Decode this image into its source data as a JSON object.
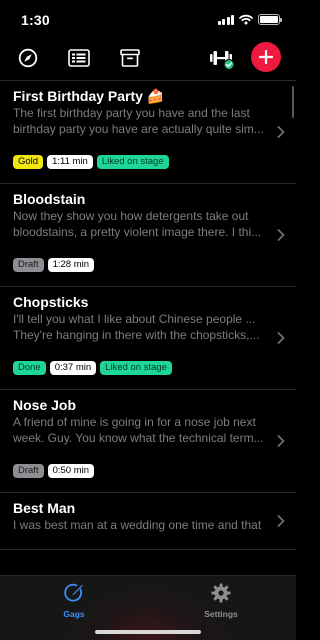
{
  "status_bar": {
    "time": "1:30"
  },
  "toolbar": {
    "icons": [
      "compass-icon",
      "list-icon",
      "archive-icon",
      "dumbbell-icon",
      "plus-icon"
    ]
  },
  "gags": [
    {
      "title": "First Birthday Party 🍰",
      "body_line1": "The first birthday party you have and the last",
      "body_line2": "birthday party you have are actually quite sim...",
      "tags": [
        {
          "text": "Gold",
          "style": "gold"
        },
        {
          "text": "1:11 min",
          "style": "time"
        },
        {
          "text": "Liked on stage",
          "style": "liked"
        }
      ]
    },
    {
      "title": "Bloodstain",
      "body_line1": "Now they show you how detergents take out",
      "body_line2": "bloodstains, a pretty violent image there. I thi...",
      "tags": [
        {
          "text": "Draft",
          "style": "draft"
        },
        {
          "text": "1:28 min",
          "style": "time"
        }
      ]
    },
    {
      "title": "Chopsticks",
      "body_line1": "I'll tell you what I like about Chinese people ...",
      "body_line2": "They're hanging in there with the chopsticks,...",
      "tags": [
        {
          "text": "Done",
          "style": "done"
        },
        {
          "text": "0:37 min",
          "style": "time"
        },
        {
          "text": "Liked on stage",
          "style": "liked"
        }
      ]
    },
    {
      "title": "Nose Job",
      "body_line1": "A friend of mine is going in for a nose job next",
      "body_line2": "week. Guy. You know what the technical term...",
      "tags": [
        {
          "text": "Draft",
          "style": "draft"
        },
        {
          "text": "0:50 min",
          "style": "time"
        }
      ]
    },
    {
      "title": "Best Man",
      "body_line1": "I was best man at a wedding one time and that",
      "body_line2": "",
      "tags": []
    }
  ],
  "tag_styles": {
    "gold": {
      "bg": "#f2e60e",
      "fg": "#000000",
      "border": "#f2e60e"
    },
    "time": {
      "bg": "#ffffff",
      "fg": "#000000",
      "border": "#ffffff"
    },
    "liked": {
      "bg": "#1fd69a",
      "fg": "#003a26",
      "border": "#1fd69a"
    },
    "draft": {
      "bg": "#8e8e93",
      "fg": "#1a1a1a",
      "border": "#8e8e93"
    },
    "done": {
      "bg": "#1fd69a",
      "fg": "#003a26",
      "border": "#1fd69a"
    }
  },
  "tabbar": {
    "tabs": [
      {
        "label": "Gags",
        "icon": "pen-circle-icon",
        "active": true
      },
      {
        "label": "Settings",
        "icon": "gear-icon",
        "active": false
      }
    ]
  },
  "colors": {
    "accent_blue": "#3d8ef5",
    "add_red": "#f0193f",
    "checkmark_green": "#27c27e"
  }
}
